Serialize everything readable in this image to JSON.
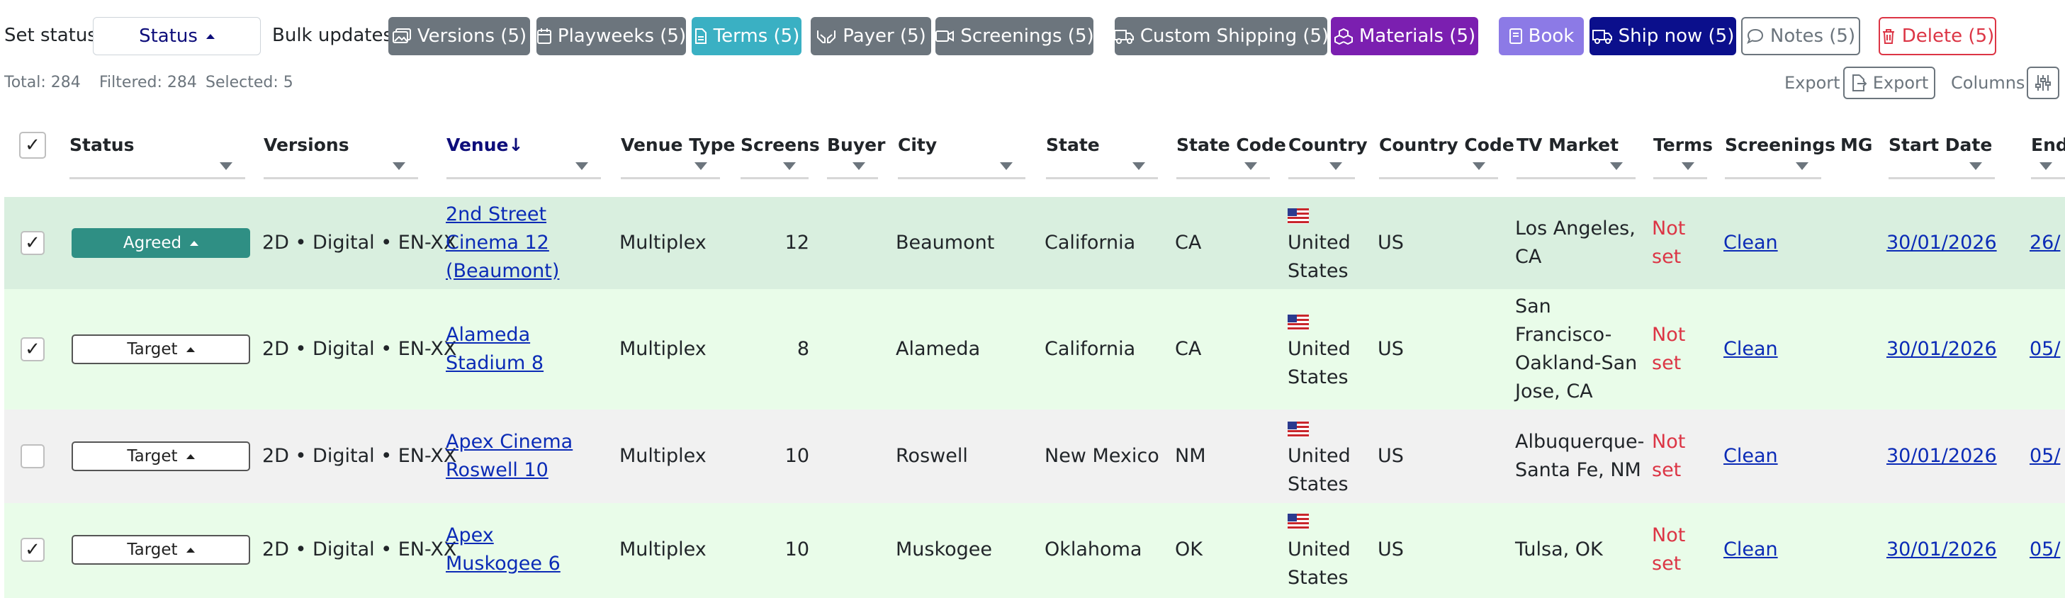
{
  "toolbar": {
    "set_status_label": "Set status",
    "status_select_value": "Status",
    "bulk_updates_label": "Bulk updates",
    "buttons": {
      "versions": "Versions (5)",
      "playweeks": "Playweeks (5)",
      "terms": "Terms (5)",
      "payer": "Payer (5)",
      "screenings": "Screenings (5)",
      "custom_shipping": "Custom Shipping (5)",
      "materials": "Materials (5)",
      "book": "Book",
      "ship_now": "Ship now (5)",
      "notes": "Notes (5)",
      "delete": "Delete (5)"
    }
  },
  "summary": {
    "total": "Total: 284",
    "filtered": "Filtered: 284",
    "selected": "Selected: 5",
    "export_label": "Export",
    "export_button": "Export",
    "columns_label": "Columns"
  },
  "table": {
    "headers": {
      "status": "Status",
      "versions": "Versions",
      "venue": "Venue",
      "venue_type": "Venue Type",
      "screens": "Screens",
      "buyer": "Buyer",
      "city": "City",
      "state": "State",
      "state_code": "State Code",
      "country": "Country",
      "country_code": "Country Code",
      "tv_market": "TV Market",
      "terms": "Terms",
      "screenings": "Screenings",
      "mg": "MG",
      "start_date": "Start Date",
      "end_date": "End"
    },
    "sort_indicator": "↓",
    "rows": [
      {
        "selected": true,
        "checkmark": "✓",
        "status": "Agreed",
        "versions": "2D • Digital • EN-XX",
        "venue_lines": [
          "2nd Street",
          "Cinema 12",
          "(Beaumont)"
        ],
        "venue_type": "Multiplex",
        "screens": "12",
        "city": "Beaumont",
        "state": "California",
        "state_code": "CA",
        "country_lines": [
          "United",
          "States"
        ],
        "country_code": "US",
        "tv_market_lines": [
          "Los Angeles,",
          "CA"
        ],
        "terms_lines": [
          "Not",
          "set"
        ],
        "screenings": "Clean",
        "start_date": "30/01/2026",
        "end_date": "26/"
      },
      {
        "selected": true,
        "checkmark": "✓",
        "status": "Target",
        "versions": "2D • Digital • EN-XX",
        "venue_lines": [
          "Alameda",
          "Stadium 8"
        ],
        "venue_type": "Multiplex",
        "screens": "8",
        "city": "Alameda",
        "state": "California",
        "state_code": "CA",
        "country_lines": [
          "United",
          "States"
        ],
        "country_code": "US",
        "tv_market_lines": [
          "San",
          "Francisco-",
          "Oakland-San",
          "Jose, CA"
        ],
        "terms_lines": [
          "Not",
          "set"
        ],
        "screenings": "Clean",
        "start_date": "30/01/2026",
        "end_date": "05/"
      },
      {
        "selected": false,
        "checkmark": "",
        "status": "Target",
        "versions": "2D • Digital • EN-XX",
        "venue_lines": [
          "Apex Cinema",
          "Roswell 10"
        ],
        "venue_type": "Multiplex",
        "screens": "10",
        "city": "Roswell",
        "state": "New Mexico",
        "state_code": "NM",
        "country_lines": [
          "United",
          "States"
        ],
        "country_code": "US",
        "tv_market_lines": [
          "Albuquerque-",
          "Santa Fe, NM"
        ],
        "terms_lines": [
          "Not",
          "set"
        ],
        "screenings": "Clean",
        "start_date": "30/01/2026",
        "end_date": "05/"
      },
      {
        "selected": true,
        "checkmark": "✓",
        "status": "Target",
        "versions": "2D • Digital • EN-XX",
        "venue_lines": [
          "Apex",
          "Muskogee 6"
        ],
        "venue_type": "Multiplex",
        "screens": "10",
        "city": "Muskogee",
        "state": "Oklahoma",
        "state_code": "OK",
        "country_lines": [
          "United",
          "States"
        ],
        "country_code": "US",
        "tv_market_lines": [
          "Tulsa, OK"
        ],
        "terms_lines": [
          "Not",
          "set"
        ],
        "screenings": "Clean",
        "start_date": "30/01/2026",
        "end_date": "05/"
      }
    ]
  },
  "colors": {
    "selected_row_bg": "#e9fce9",
    "agreed_row_bg": "#d9efdf",
    "unselected_row_bg": "#f1f1f1",
    "agreed_pill": "#2f8f84",
    "link": "#0b2bb6",
    "not_set": "#dc3545"
  }
}
